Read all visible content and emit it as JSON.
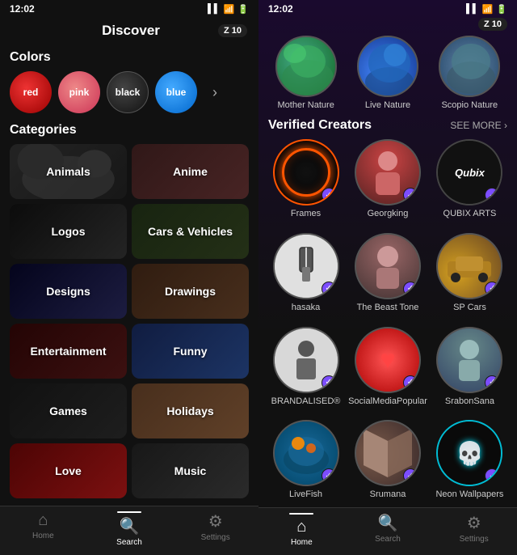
{
  "left": {
    "statusBar": {
      "time": "12:02",
      "signal": "▌▌",
      "wifi": "wifi",
      "battery": "🔋"
    },
    "header": {
      "title": "Discover",
      "badge": "Z 10"
    },
    "colors": {
      "sectionTitle": "Colors",
      "items": [
        {
          "label": "red",
          "class": "color-red"
        },
        {
          "label": "pink",
          "class": "color-pink"
        },
        {
          "label": "black",
          "class": "color-black"
        },
        {
          "label": "blue",
          "class": "color-blue"
        }
      ],
      "more": "›"
    },
    "categories": {
      "sectionTitle": "Categories",
      "items": [
        {
          "label": "Animals",
          "class": "cat-animals"
        },
        {
          "label": "Anime",
          "class": "cat-anime"
        },
        {
          "label": "Logos",
          "class": "cat-logos"
        },
        {
          "label": "Cars & Vehicles",
          "class": "cat-cars"
        },
        {
          "label": "Designs",
          "class": "cat-designs"
        },
        {
          "label": "Drawings",
          "class": "cat-drawings"
        },
        {
          "label": "Entertainment",
          "class": "cat-entertainment"
        },
        {
          "label": "Funny",
          "class": "cat-funny"
        },
        {
          "label": "Games",
          "class": "cat-games"
        },
        {
          "label": "Holidays",
          "class": "cat-holidays"
        },
        {
          "label": "Love",
          "class": "cat-love"
        },
        {
          "label": "Music",
          "class": "cat-music"
        }
      ]
    },
    "bottomNav": {
      "items": [
        {
          "label": "Home",
          "icon": "⌂",
          "active": false
        },
        {
          "label": "Search",
          "icon": "🔍",
          "active": true
        },
        {
          "label": "Settings",
          "icon": "⚙",
          "active": false
        }
      ]
    }
  },
  "right": {
    "statusBar": {
      "time": "12:02",
      "signal": "▌▌",
      "wifi": "wifi",
      "battery": "🔋"
    },
    "badge": "Z 10",
    "natureItems": [
      {
        "label": "Mother Nature",
        "class": "mother"
      },
      {
        "label": "Live Nature",
        "class": "live"
      },
      {
        "label": "Scopio Nature",
        "class": "scopio"
      }
    ],
    "verifiedSection": {
      "title": "Verified Creators",
      "seeMore": "SEE MORE ›"
    },
    "creators": [
      {
        "name": "Frames",
        "avClass": "av-frames",
        "content": "ring"
      },
      {
        "name": "Georgking",
        "avClass": "av-georgking",
        "content": "person"
      },
      {
        "name": "QUBIX ARTS",
        "avClass": "av-qubix",
        "content": "qubix"
      },
      {
        "name": "hasaka",
        "avClass": "av-hasaka",
        "content": "battery"
      },
      {
        "name": "The Beast Tone",
        "avClass": "av-beast",
        "content": "person"
      },
      {
        "name": "SP Cars",
        "avClass": "av-spcars",
        "content": "car"
      },
      {
        "name": "BRANDALISED®",
        "avClass": "av-brand",
        "content": "brand"
      },
      {
        "name": "SocialMediaPopular",
        "avClass": "av-social",
        "content": "heart"
      },
      {
        "name": "SrabonSana",
        "avClass": "av-srabon",
        "content": "person"
      },
      {
        "name": "LiveFish",
        "avClass": "av-livefish",
        "content": "fish"
      },
      {
        "name": "Srumana",
        "avClass": "av-srumana",
        "content": "flag"
      },
      {
        "name": "Neon Wallpapers",
        "avClass": "av-neon",
        "content": "skull"
      }
    ],
    "bottomNav": {
      "items": [
        {
          "label": "Home",
          "icon": "⌂",
          "active": true
        },
        {
          "label": "Search",
          "icon": "🔍",
          "active": false
        },
        {
          "label": "Settings",
          "icon": "⚙",
          "active": false
        }
      ]
    }
  }
}
